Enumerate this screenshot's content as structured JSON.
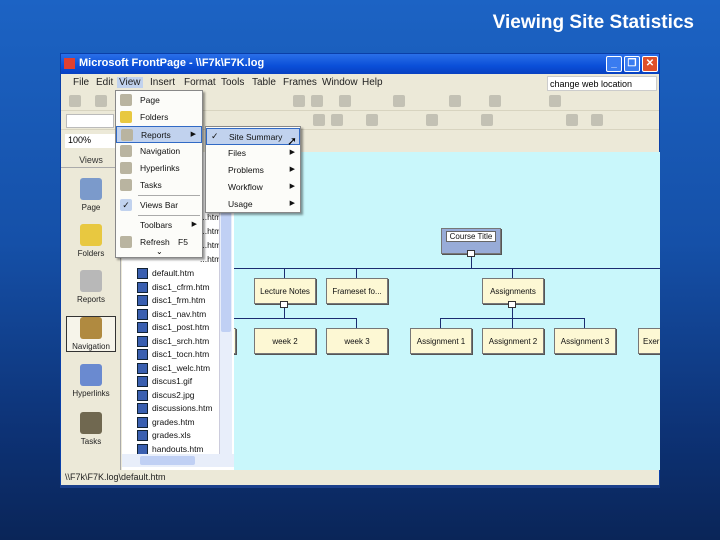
{
  "slide_title": "Viewing Site Statistics",
  "window": {
    "title": "Microsoft FrontPage - \\\\F7k\\F7K.log",
    "minimize": "_",
    "restore": "❐",
    "close": "✕"
  },
  "menubar": [
    "File",
    "Edit",
    "View",
    "Insert",
    "Format",
    "Tools",
    "Table",
    "Frames",
    "Window",
    "Help"
  ],
  "web_location": "change web location",
  "zoom": "100%",
  "views_bar": {
    "header": "Views",
    "items": [
      "Page",
      "Folders",
      "Reports",
      "Navigation",
      "Hyperlinks",
      "Tasks"
    ]
  },
  "view_menu": {
    "items": [
      {
        "label": "Page"
      },
      {
        "label": "Folders"
      },
      {
        "label": "Reports",
        "arrow": "▶"
      },
      {
        "label": "Navigation"
      },
      {
        "label": "Hyperlinks"
      },
      {
        "label": "Tasks"
      },
      {
        "label": "Views Bar",
        "check": "✓"
      },
      {
        "label": "Toolbars",
        "arrow": "▶"
      },
      {
        "label": "Refresh",
        "shortcut": "F5"
      }
    ],
    "more": "⌄"
  },
  "reports_submenu": {
    "check": "✓",
    "items": [
      {
        "label": "Site Summary"
      },
      {
        "label": "Files",
        "arrow": "▶"
      },
      {
        "label": "Problems",
        "arrow": "▶"
      },
      {
        "label": "Workflow",
        "arrow": "▶"
      },
      {
        "label": "Usage",
        "arrow": "▶"
      }
    ]
  },
  "folder_list": {
    "partial": [
      "...htm",
      "...htm",
      "...htm",
      "...htm"
    ],
    "files": [
      "default.htm",
      "disc1_cfrm.htm",
      "disc1_frm.htm",
      "disc1_nav.htm",
      "disc1_post.htm",
      "disc1_srch.htm",
      "disc1_tocn.htm",
      "disc1_welc.htm",
      "discus1.gif",
      "discus2.jpg",
      "discussions.htm",
      "grades.htm",
      "grades.xls",
      "handouts.htm"
    ]
  },
  "navigation": {
    "root": "Course Title",
    "level1": [
      "Lecture Notes",
      "Frameset fo...",
      "Assignments"
    ],
    "level2": [
      "week 2",
      "week 3",
      "Assignment 1",
      "Assignment 2",
      "Assignment 3",
      "Exer"
    ]
  },
  "status_bar": "\\\\F7k\\F7K.log\\default.htm"
}
